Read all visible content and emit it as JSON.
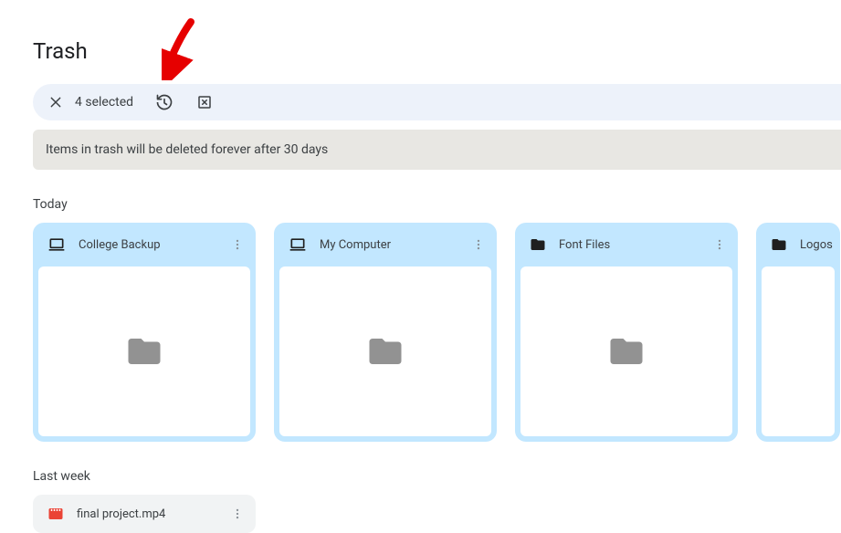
{
  "page": {
    "title": "Trash"
  },
  "selection": {
    "count_label": "4 selected"
  },
  "notice": {
    "text": "Items in trash will be deleted forever after 30 days"
  },
  "sections": {
    "today": {
      "label": "Today",
      "items": [
        {
          "title": "College Backup",
          "icon": "laptop"
        },
        {
          "title": "My Computer",
          "icon": "laptop"
        },
        {
          "title": "Font Files",
          "icon": "folder"
        },
        {
          "title": "Logos",
          "icon": "folder"
        }
      ]
    },
    "lastweek": {
      "label": "Last week",
      "items": [
        {
          "title": "final project.mp4",
          "icon": "video"
        }
      ]
    }
  }
}
